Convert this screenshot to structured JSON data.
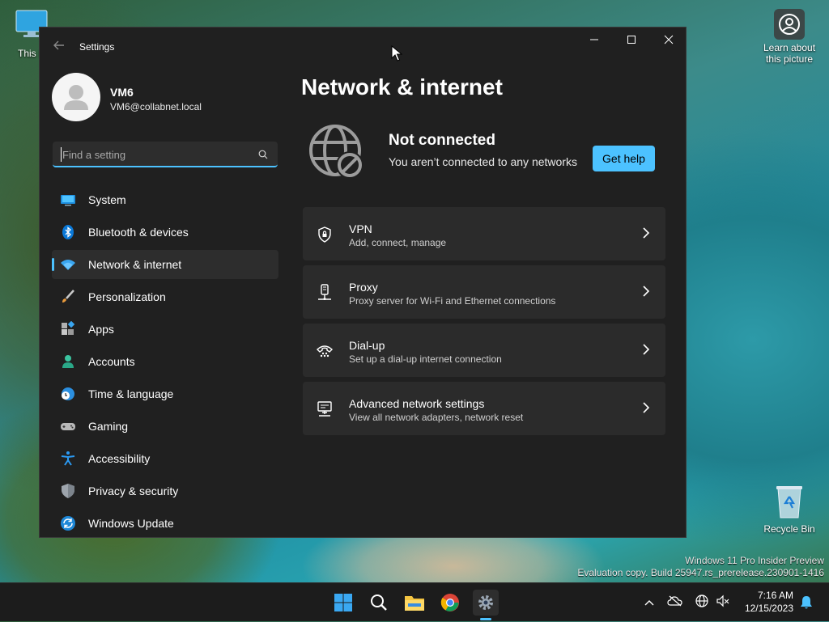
{
  "desktop": {
    "this_pc_label": "This P",
    "learn_label_line1": "Learn about",
    "learn_label_line2": "this picture",
    "recycle_bin_label": "Recycle Bin",
    "watermark_line1": "Windows 11 Pro Insider Preview",
    "watermark_line2": "Evaluation copy. Build 25947.rs_prerelease.230901-1416"
  },
  "window": {
    "title": "Settings"
  },
  "user": {
    "name": "VM6",
    "email": "VM6@collabnet.local"
  },
  "search": {
    "placeholder": "Find a setting"
  },
  "nav": {
    "items": [
      {
        "label": "System",
        "icon": "monitor-icon"
      },
      {
        "label": "Bluetooth & devices",
        "icon": "bluetooth-icon"
      },
      {
        "label": "Network & internet",
        "icon": "wifi-icon",
        "active": true
      },
      {
        "label": "Personalization",
        "icon": "brush-icon"
      },
      {
        "label": "Apps",
        "icon": "apps-icon"
      },
      {
        "label": "Accounts",
        "icon": "person-icon"
      },
      {
        "label": "Time & language",
        "icon": "globe-clock-icon"
      },
      {
        "label": "Gaming",
        "icon": "gamepad-icon"
      },
      {
        "label": "Accessibility",
        "icon": "accessibility-icon"
      },
      {
        "label": "Privacy & security",
        "icon": "shield-icon"
      },
      {
        "label": "Windows Update",
        "icon": "update-icon"
      }
    ]
  },
  "main": {
    "title": "Network & internet",
    "status": {
      "title": "Not connected",
      "subtitle": "You aren’t connected to any networks",
      "help_button": "Get help"
    },
    "cards": [
      {
        "title": "VPN",
        "subtitle": "Add, connect, manage",
        "icon": "vpn-shield-icon"
      },
      {
        "title": "Proxy",
        "subtitle": "Proxy server for Wi-Fi and Ethernet connections",
        "icon": "proxy-icon"
      },
      {
        "title": "Dial-up",
        "subtitle": "Set up a dial-up internet connection",
        "icon": "dialup-phone-icon"
      },
      {
        "title": "Advanced network settings",
        "subtitle": "View all network adapters, network reset",
        "icon": "network-adapter-icon"
      }
    ]
  },
  "taskbar": {
    "time": "7:16 AM",
    "date": "12/15/2023"
  },
  "colors": {
    "accent": "#4cc2ff",
    "window_bg": "#202020",
    "card_bg": "#2b2b2b"
  }
}
